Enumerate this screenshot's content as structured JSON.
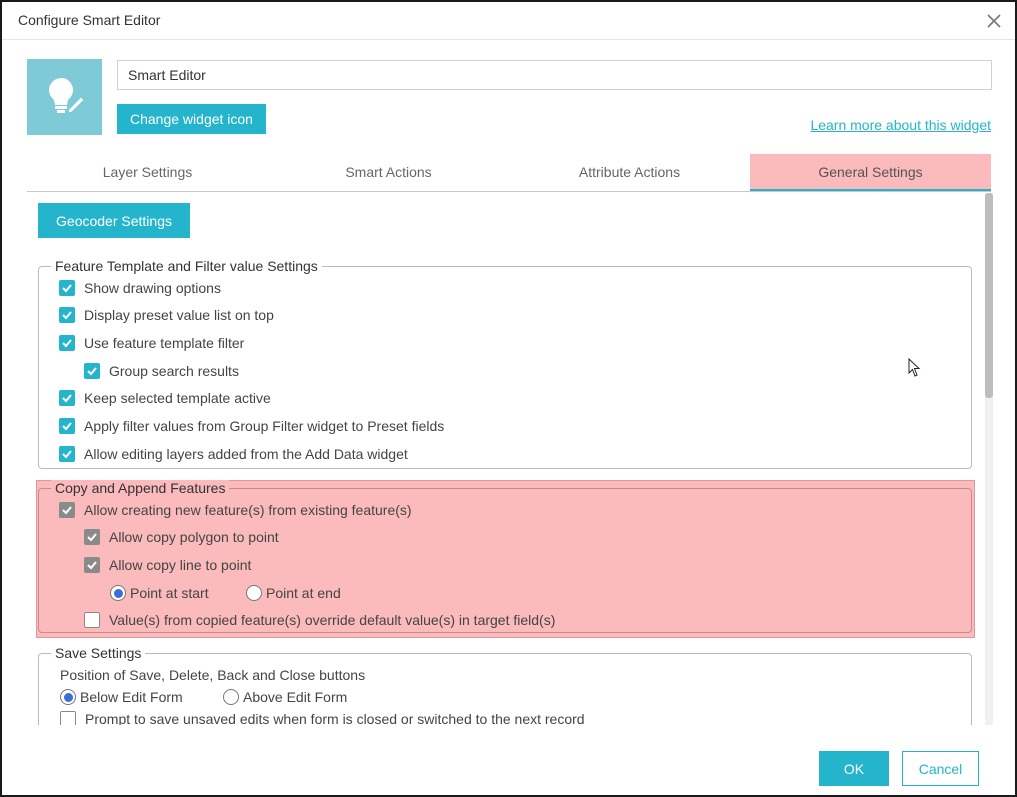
{
  "window": {
    "title": "Configure Smart Editor",
    "close_icon": "close-icon"
  },
  "header": {
    "widget_name": "Smart Editor",
    "change_icon_label": "Change widget icon",
    "learn_more_label": "Learn more about this widget",
    "widget_icon": "lightbulb-pencil-icon",
    "icon_color": "#7ecad6"
  },
  "tabs": [
    {
      "label": "Layer Settings",
      "active": false
    },
    {
      "label": "Smart Actions",
      "active": false
    },
    {
      "label": "Attribute Actions",
      "active": false
    },
    {
      "label": "General Settings",
      "active": true
    }
  ],
  "general": {
    "geocoder_label": "Geocoder Settings",
    "template_section": {
      "legend": "Feature Template and Filter value Settings",
      "items": [
        {
          "label": "Show drawing options",
          "checked": true
        },
        {
          "label": "Display preset value list on top",
          "checked": true
        },
        {
          "label": "Use feature template filter",
          "checked": true
        },
        {
          "label": "Group search results",
          "checked": true
        },
        {
          "label": "Keep selected template active",
          "checked": true
        },
        {
          "label": "Apply filter values from Group Filter widget to Preset fields",
          "checked": true
        },
        {
          "label": "Allow editing layers added from the Add Data widget",
          "checked": true
        }
      ]
    },
    "copy_section": {
      "legend": "Copy and Append Features",
      "allow_create": {
        "label": "Allow creating new feature(s) from existing feature(s)",
        "checked": true
      },
      "copy_polygon": {
        "label": "Allow copy polygon to point",
        "checked": true
      },
      "copy_line": {
        "label": "Allow copy line to point",
        "checked": true
      },
      "point_start": {
        "label": "Point at start",
        "selected": true
      },
      "point_end": {
        "label": "Point at end",
        "selected": false
      },
      "override": {
        "label": "Value(s) from copied feature(s) override default value(s) in target field(s)",
        "checked": false
      }
    },
    "save_section": {
      "legend": "Save Settings",
      "position_label": "Position of Save, Delete, Back and Close buttons",
      "below": {
        "label": "Below Edit Form",
        "selected": true
      },
      "above": {
        "label": "Above Edit Form",
        "selected": false
      },
      "prompt": {
        "label": "Prompt to save unsaved edits when form is closed or switched to the next record",
        "checked": false
      }
    }
  },
  "footer": {
    "ok_label": "OK",
    "cancel_label": "Cancel"
  },
  "colors": {
    "accent": "#24b5cc",
    "highlight": "#fbbabb"
  }
}
